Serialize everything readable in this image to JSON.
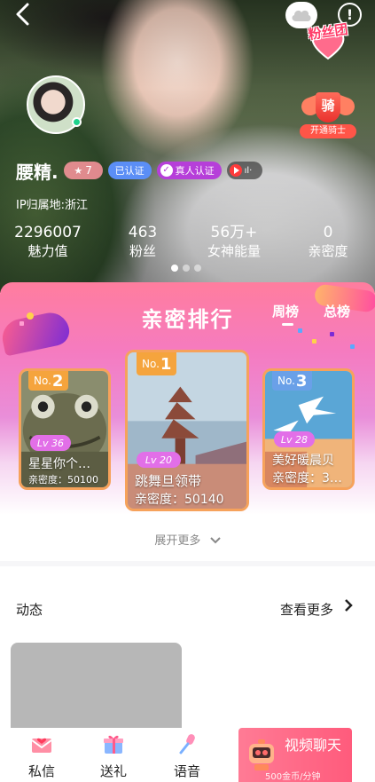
{
  "header": {
    "back_icon": "chevron-left-icon",
    "fan_club_label": "粉丝团",
    "knight_icon_char": "骑",
    "knight_label": "开通骑士"
  },
  "profile": {
    "name": "腰精.",
    "level": "7",
    "certified_label": "已认证",
    "real_person_label": "真人认证",
    "ip_location": "IP归属地:浙江"
  },
  "stats": [
    {
      "value": "2296007",
      "label": "魅力值"
    },
    {
      "value": "463",
      "label": "粉丝"
    },
    {
      "value": "56万+",
      "label": "女神能量"
    },
    {
      "value": "0",
      "label": "亲密度"
    }
  ],
  "carousel": {
    "total": 3,
    "active": 0
  },
  "ranking": {
    "title": "亲密排行",
    "tabs": [
      {
        "label": "周榜",
        "active": true
      },
      {
        "label": "总榜",
        "active": false
      }
    ],
    "no_prefix": "No.",
    "cards": [
      {
        "rank": "2",
        "level": "Lv 36",
        "name": "星星你个…",
        "intimacy": "亲密度：50100"
      },
      {
        "rank": "1",
        "level": "Lv 20",
        "name": "跳舞旦领带",
        "intimacy": "亲密度：50140"
      },
      {
        "rank": "3",
        "level": "Lv 28",
        "name": "美好暖晨贝",
        "intimacy": "亲密度：3…"
      }
    ],
    "expand_label": "展开更多"
  },
  "dynamic": {
    "title": "动态",
    "more_label": "查看更多"
  },
  "bottom_bar": {
    "message_label": "私信",
    "gift_label": "送礼",
    "voice_label": "语音",
    "video_title": "视频聊天",
    "video_price": "500金币/分钟"
  },
  "colors": {
    "accent_pink": "#ff5b7c",
    "cert_blue": "#5b8ef6",
    "real_purple": "#b63fd9",
    "online_green": "#1ed28c",
    "rank_gold": "#f5a43d"
  }
}
